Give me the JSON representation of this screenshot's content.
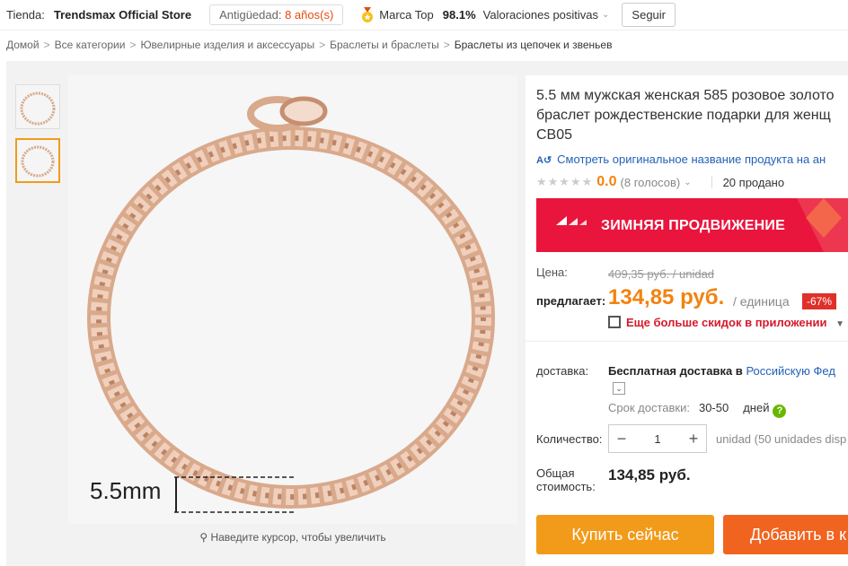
{
  "store": {
    "label": "Tienda:",
    "name": "Trendsmax Official Store",
    "age_label": "Antigüedad:",
    "age_value": "8 años(s)",
    "brand_label": "Marca Top",
    "rating_pct": "98.1%",
    "positive_label": "Valoraciones positivas",
    "follow_label": "Seguir"
  },
  "breadcrumb": [
    "Домой",
    "Все категории",
    "Ювелирные изделия и аксессуары",
    "Браслеты и браслеты",
    "Браслеты из цепочек и звеньев"
  ],
  "breadcrumb_sep": ">",
  "gallery": {
    "measure_label": "5.5mm",
    "zoom_hint": "Наведите курсор, чтобы увеличить"
  },
  "product": {
    "title": "5.5 мм мужская женская 585 розовое золото\nбраслет рождественские подарки для женщ\nCB05",
    "original_link": "Смотреть оригинальное название продукта на ан",
    "rating": "0.0",
    "votes": "(8 голосов)",
    "sold": "20 продано",
    "promo": "ЗИМНЯЯ ПРОДВИЖЕНИЕ",
    "price_label": "Цена:",
    "old_price": "409,35 руб. / unidad",
    "offer_label": "предлагает:",
    "price": "134,85 руб.",
    "unit": "/ единица",
    "discount": "-67%",
    "app_discount": "Еще больше скидок в приложении"
  },
  "shipping": {
    "label": "доставка:",
    "text": "Бесплатная доставка в",
    "destination": "Российскую Фед",
    "time_label": "Срок доставки:",
    "time_value": "30-50",
    "days": "дней",
    "help": "?"
  },
  "quantity": {
    "label": "Количество:",
    "value": "1",
    "minus": "−",
    "plus": "+",
    "note": "unidad (50 unidades disp"
  },
  "total": {
    "label": "Общая стоимость:",
    "value": "134,85 руб."
  },
  "actions": {
    "buy": "Купить сейчас",
    "cart": "Добавить в к"
  },
  "colors": {
    "accent_orange": "#f29b1a",
    "price_orange": "#f2830f",
    "promo_red": "#e9153c",
    "link_blue": "#2461b8",
    "cart_orange": "#f06420"
  }
}
